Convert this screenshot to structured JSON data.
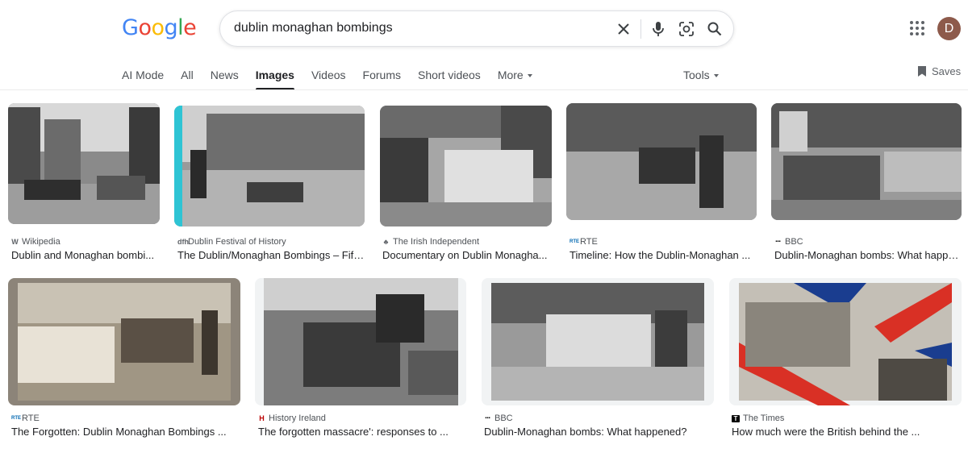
{
  "logo": {
    "text": "Google"
  },
  "search": {
    "query": "dublin monaghan bombings"
  },
  "header": {
    "avatar_letter": "D"
  },
  "tabs": [
    {
      "label": "AI Mode"
    },
    {
      "label": "All"
    },
    {
      "label": "News"
    },
    {
      "label": "Images"
    },
    {
      "label": "Videos"
    },
    {
      "label": "Forums"
    },
    {
      "label": "Short videos"
    },
    {
      "label": "More"
    }
  ],
  "tools_label": "Tools",
  "saves_label": "Saves",
  "results": [
    {
      "source": "Wikipedia",
      "favicon": "W",
      "title": "Dublin and Monaghan bombi..."
    },
    {
      "source": "Dublin Festival of History",
      "favicon": "dfh",
      "title": "The Dublin/Monaghan Bombings – Fift..."
    },
    {
      "source": "The Irish Independent",
      "favicon": "♣",
      "title": "Documentary on Dublin Monagha..."
    },
    {
      "source": "RTE",
      "favicon": "RTE",
      "title": "Timeline: How the Dublin-Monaghan ..."
    },
    {
      "source": "BBC",
      "favicon": "▪▪▪",
      "title": "Dublin-Monaghan bombs: What happe..."
    },
    {
      "source": "RTE",
      "favicon": "RTE",
      "title": "The Forgotten: Dublin Monaghan Bombings ..."
    },
    {
      "source": "History Ireland",
      "favicon": "H",
      "title": "The forgotten massacre': responses to ..."
    },
    {
      "source": "BBC",
      "favicon": "▪▪▪",
      "title": "Dublin-Monaghan bombs: What happened?"
    },
    {
      "source": "The Times",
      "favicon": "T",
      "title": "How much were the British behind the ..."
    }
  ],
  "colors": {
    "logo_blue": "#4285f4",
    "logo_red": "#ea4335",
    "logo_yellow": "#fbbc05",
    "logo_green": "#34a853",
    "accent_teal": "#2ec4d4"
  },
  "icons": [
    "clear-icon",
    "mic-icon",
    "lens-icon",
    "search-icon",
    "apps-icon",
    "bookmark-icon"
  ]
}
